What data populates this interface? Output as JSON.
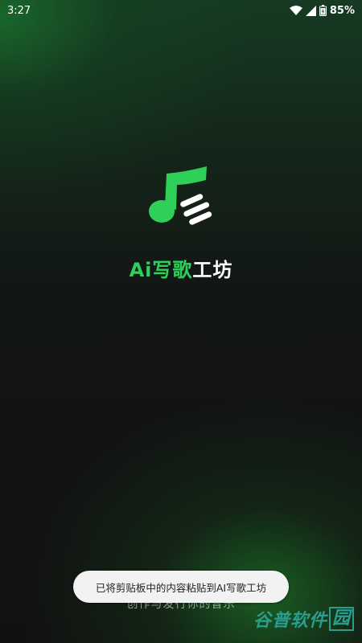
{
  "status_bar": {
    "time": "3:27",
    "battery": "85%",
    "icons": [
      "wifi-icon",
      "cell-signal-icon",
      "battery-icon"
    ]
  },
  "app": {
    "name_part1": "Ai写歌",
    "name_part2": "工坊",
    "accent_color": "#2fd05a",
    "logo_icon": "music-note-logo-icon"
  },
  "tagline": "创作与发行你的音乐",
  "toast": {
    "text": "已将剪贴板中的内容粘贴到AI写歌工坊"
  },
  "watermark": {
    "part1": "谷普",
    "part2": "软件",
    "part3": "园"
  }
}
